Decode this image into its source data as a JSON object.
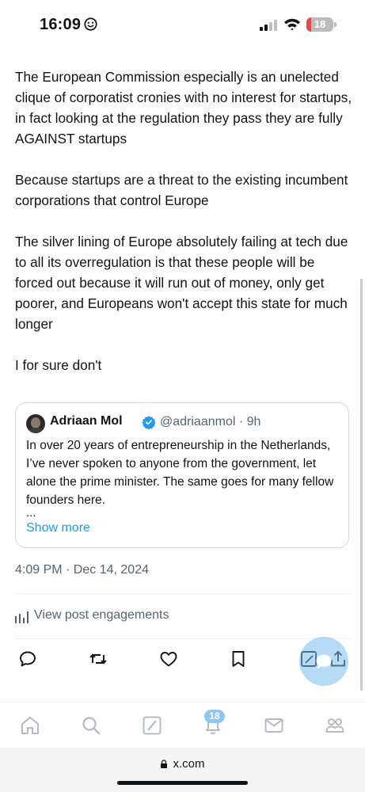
{
  "status_bar": {
    "time": "16:09",
    "battery": "18",
    "battery_level": 0.18
  },
  "post": {
    "paragraphs": [
      "The European Commission especially is an unelected clique of corporatist cronies with no interest for startups, in fact looking at the regulation they pass they are fully AGAINST startups",
      "Because startups are a threat to the existing incumbent corporations that control Europe",
      "The silver lining of Europe absolutely failing at tech due to all its overregulation is that these people will be forced out because it will run out of money, only get poorer, and Europeans won't accept this state for much longer",
      "I for sure don't"
    ],
    "quote": {
      "author_name": "Adriaan Mol",
      "author_handle_time": "@adriaanmol · 9h",
      "text": "In over 20 years of entrepreneurship in the Netherlands, I’ve never spoken to anyone from the government, let alone the prime minister. The same goes for many fellow founders here.",
      "ellipsis": "...",
      "show_more": "Show more"
    },
    "timestamp": "4:09 PM · Dec 14, 2024",
    "engagements_label": "View post engagements"
  },
  "actions": [
    "reply-icon",
    "repost-icon",
    "like-icon",
    "bookmark-icon",
    "share-icon"
  ],
  "tab_bar": {
    "notifications_badge": "18"
  },
  "browser": {
    "url": "x.com"
  },
  "colors": {
    "accent": "#1d9bf0",
    "text": "#0f1419",
    "secondary": "#536471"
  }
}
